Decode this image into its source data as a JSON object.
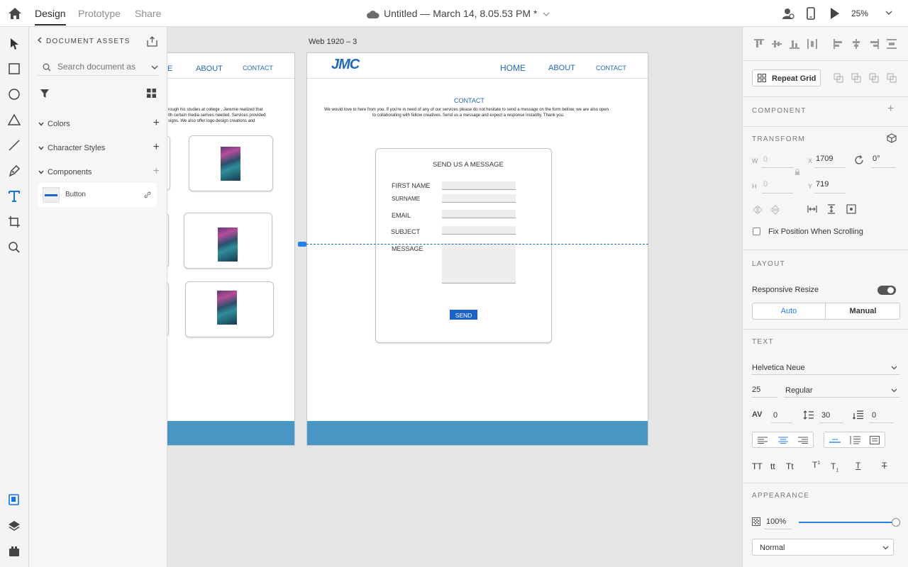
{
  "topbar": {
    "tabs": [
      "Design",
      "Prototype",
      "Share"
    ],
    "doc_title": "Untitled — March 14, 8.05.53 PM *",
    "zoom": "25%"
  },
  "assets": {
    "header": "DOCUMENT ASSETS",
    "search_placeholder": "Search document assets",
    "sections": [
      "Colors",
      "Character Styles",
      "Components"
    ],
    "component_name": "Button"
  },
  "canvas": {
    "artboard_label": "Web 1920 – 3",
    "left_artboard": {
      "nav": [
        "E",
        "ABOUT",
        "CONTACT"
      ],
      "body_lines": [
        "rough his studies at college , Jeremie realized that",
        "ith certain media serives needed. Services provided",
        "signs. We also offer logo design creations and"
      ]
    },
    "right_artboard": {
      "logo": "JMC",
      "nav": [
        "HOME",
        "ABOUT",
        "CONTACT"
      ],
      "heading": "CONTACT",
      "intro": [
        "We would love to here from you. If you're in need of any of our services please do not hesitate to send a message on the form bellow, we are also open",
        "to collaborating with fellow creatives. Send us a message and expect a response instantly. Thank you."
      ],
      "form": {
        "title": "SEND US A MESSAGE",
        "fields": [
          "FIRST NAME",
          "SURNAME",
          "EMAIL",
          "SUBJECT",
          "MESSAGE"
        ],
        "button": "SEND"
      }
    }
  },
  "props": {
    "repeat_grid": "Repeat Grid",
    "component_title": "COMPONENT",
    "transform_title": "TRANSFORM",
    "w_label": "W",
    "w_value": "0",
    "h_label": "H",
    "h_value": "0",
    "x_label": "X",
    "x_value": "1709",
    "y_label": "Y",
    "y_value": "719",
    "rotation": "0°",
    "fix_position": "Fix Position When Scrolling",
    "layout_title": "LAYOUT",
    "responsive_resize": "Responsive Resize",
    "auto": "Auto",
    "manual": "Manual",
    "text_title": "TEXT",
    "font": "Helvetica Neue",
    "font_size": "25",
    "font_weight": "Regular",
    "char_spacing": "0",
    "line_spacing": "30",
    "para_spacing": "0",
    "transform_buttons": [
      "TT",
      "tt",
      "Tt"
    ],
    "appearance_title": "APPEARANCE",
    "opacity": "100%",
    "opacity_level": 1.0,
    "blend_mode": "Normal"
  },
  "colors": {
    "accent": "#2680eb",
    "nav_blue": "#2469b5",
    "footer_blue": "#4896c3",
    "send_button": "#1c63c9"
  }
}
